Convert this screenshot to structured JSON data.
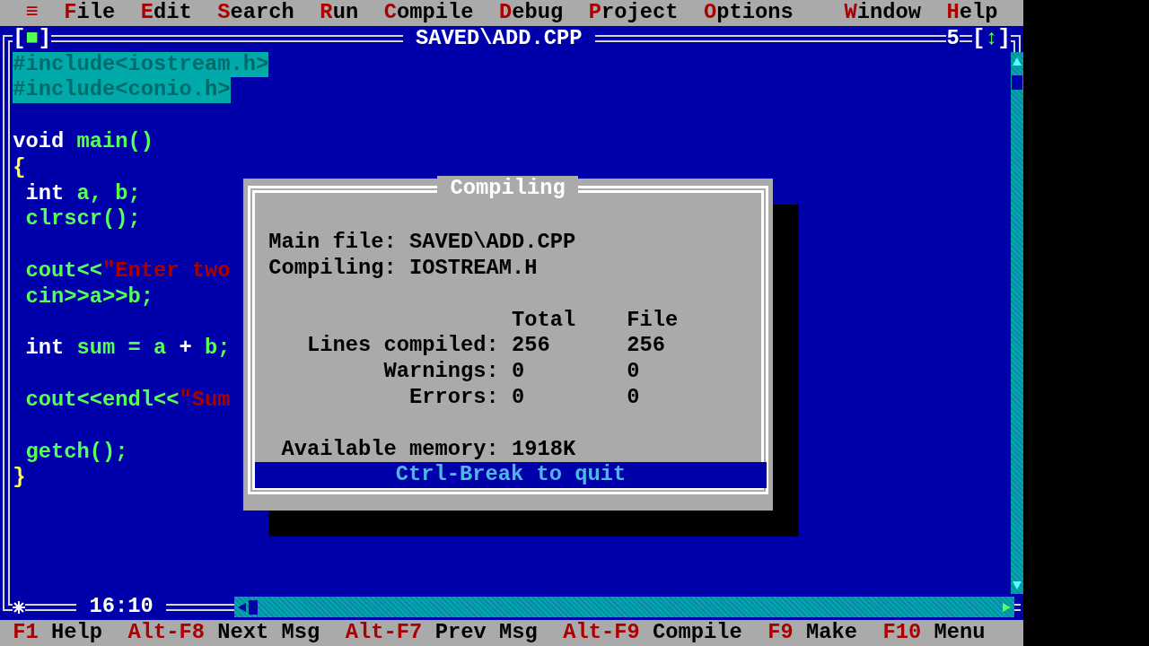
{
  "menu_bar": {
    "items": [
      {
        "kind": "system",
        "label": "≡"
      },
      {
        "kind": "menu",
        "label": "File"
      },
      {
        "kind": "menu",
        "label": "Edit"
      },
      {
        "kind": "menu",
        "label": "Search"
      },
      {
        "kind": "menu",
        "label": "Run"
      },
      {
        "kind": "menu",
        "label": "Compile"
      },
      {
        "kind": "menu",
        "label": "Debug"
      },
      {
        "kind": "menu",
        "label": "Project"
      },
      {
        "kind": "menu",
        "label": "Options"
      }
    ],
    "right_items": [
      {
        "kind": "menu",
        "label": "Window"
      },
      {
        "kind": "menu",
        "label": "Help"
      }
    ]
  },
  "editor": {
    "title": "SAVED\\ADD.CPP",
    "close_box": "[■]",
    "window_number": "5",
    "zoom_box": "[↕]",
    "modified": true,
    "cursor_position": "16:10",
    "lines": [
      {
        "kind": "code",
        "selected": true,
        "tokens": [
          {
            "kind": "ident",
            "text": "#include<iostream.h>"
          }
        ]
      },
      {
        "kind": "code",
        "selected": true,
        "tokens": [
          {
            "kind": "ident",
            "text": "#include<conio.h>"
          }
        ]
      },
      {
        "kind": "blank"
      },
      {
        "kind": "code",
        "selected": false,
        "tokens": [
          {
            "kind": "keyword",
            "text": "void"
          },
          {
            "kind": "ident",
            "text": " main()"
          }
        ]
      },
      {
        "kind": "code",
        "selected": false,
        "tokens": [
          {
            "kind": "brace",
            "text": "{"
          }
        ]
      },
      {
        "kind": "code",
        "selected": false,
        "tokens": [
          {
            "kind": "keyword",
            "text": " int"
          },
          {
            "kind": "ident",
            "text": " a, b;"
          }
        ]
      },
      {
        "kind": "code",
        "selected": false,
        "tokens": [
          {
            "kind": "ident",
            "text": " clrscr();"
          }
        ]
      },
      {
        "kind": "blank"
      },
      {
        "kind": "code",
        "selected": false,
        "tokens": [
          {
            "kind": "ident",
            "text": " cout<<"
          },
          {
            "kind": "string",
            "text": "\"Enter two"
          }
        ]
      },
      {
        "kind": "code",
        "selected": false,
        "tokens": [
          {
            "kind": "ident",
            "text": " cin>>a>>b;"
          }
        ]
      },
      {
        "kind": "blank"
      },
      {
        "kind": "code",
        "selected": false,
        "tokens": [
          {
            "kind": "keyword",
            "text": " int"
          },
          {
            "kind": "ident",
            "text": " sum = a "
          },
          {
            "kind": "keyword",
            "text": "+"
          },
          {
            "kind": "ident",
            "text": " b;"
          }
        ]
      },
      {
        "kind": "blank"
      },
      {
        "kind": "code",
        "selected": false,
        "tokens": [
          {
            "kind": "ident",
            "text": " cout<<endl<<"
          },
          {
            "kind": "string",
            "text": "\"Sum"
          }
        ]
      },
      {
        "kind": "blank"
      },
      {
        "kind": "code",
        "selected": false,
        "tokens": [
          {
            "kind": "ident",
            "text": " getch();"
          }
        ]
      },
      {
        "kind": "code",
        "selected": false,
        "tokens": [
          {
            "kind": "brace",
            "text": "}"
          }
        ]
      }
    ]
  },
  "dialog": {
    "title": "Compiling",
    "info": [
      {
        "label": "Main file:",
        "value": "SAVED\\ADD.CPP"
      },
      {
        "label": "Compiling:",
        "value": "IOSTREAM.H"
      }
    ],
    "columns": [
      "Total",
      "File"
    ],
    "stats": [
      {
        "label": "Lines compiled:",
        "total": "256",
        "file": "256"
      },
      {
        "label": "Warnings:",
        "total": "0",
        "file": "0"
      },
      {
        "label": "Errors:",
        "total": "0",
        "file": "0"
      }
    ],
    "memory": {
      "label": "Available memory:",
      "value": "1918K"
    },
    "hint": "Ctrl-Break to quit"
  },
  "status_bar": [
    {
      "key": "F1",
      "label": "Help"
    },
    {
      "key": "Alt-F8",
      "label": "Next Msg"
    },
    {
      "key": "Alt-F7",
      "label": "Prev Msg"
    },
    {
      "key": "Alt-F9",
      "label": "Compile"
    },
    {
      "key": "F9",
      "label": "Make"
    },
    {
      "key": "F10",
      "label": "Menu"
    }
  ]
}
